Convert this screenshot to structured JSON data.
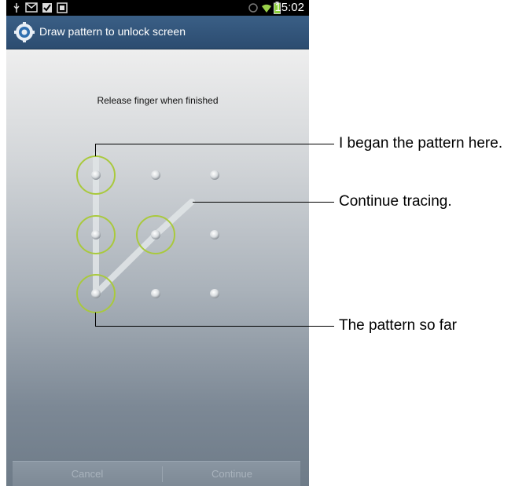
{
  "status_bar": {
    "time": "15:02",
    "icons": [
      "usb-icon",
      "mail-icon",
      "check-icon",
      "gallery-icon",
      "sync-icon",
      "wifi-icon",
      "battery-icon"
    ]
  },
  "title_bar": {
    "title": "Draw pattern to unlock screen",
    "icon": "settings-gear-icon"
  },
  "instruction": "Release finger when finished",
  "pattern": {
    "grid": "3x3",
    "selected_dots": [
      1,
      4,
      7,
      5
    ],
    "trace_direction_after_last": "toward dot 3",
    "ring_color": "#a9c93d",
    "line_color": "#dfe3e6"
  },
  "buttons": {
    "cancel": "Cancel",
    "continue": "Continue"
  },
  "callouts": {
    "began": "I began the pattern here.",
    "continue": "Continue tracing.",
    "so_far": "The pattern so far"
  }
}
